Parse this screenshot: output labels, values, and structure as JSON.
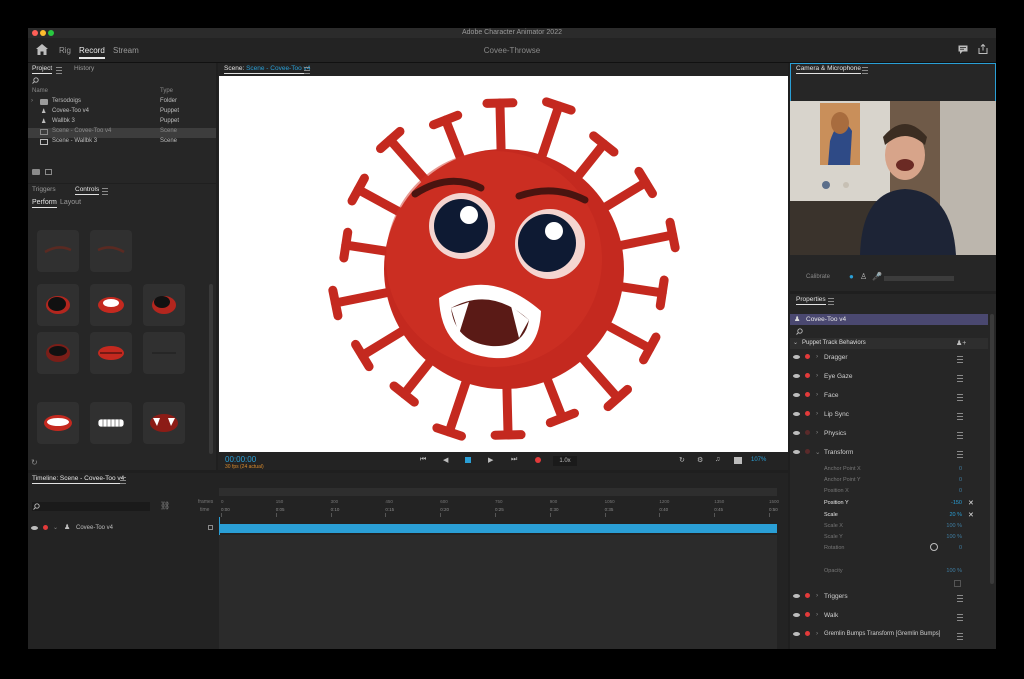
{
  "app_title": "Adobe Character Animator 2022",
  "top_tabs": [
    {
      "label": "Rig"
    },
    {
      "label": "Record"
    },
    {
      "label": "Stream"
    }
  ],
  "document_name": "Covee-Throwse",
  "project_panel": {
    "tabs": [
      "Project",
      "History"
    ],
    "columns": {
      "name": "Name",
      "type": "Type"
    },
    "items": [
      {
        "name": "Tersodoigs",
        "type": "Folder"
      },
      {
        "name": "Covee-Too v4",
        "type": "Puppet"
      },
      {
        "name": "Wallbk 3",
        "type": "Puppet"
      },
      {
        "name": "Scene - Covee-Too v4",
        "type": "Scene"
      },
      {
        "name": "Scene - Wallbk 3",
        "type": "Scene"
      }
    ]
  },
  "controls_panel": {
    "tabs": [
      "Triggers",
      "Controls"
    ],
    "subtabs": [
      "Perform",
      "Layout"
    ]
  },
  "scene_panel": {
    "label": "Scene:",
    "scene_name": "Scene - Covee-Too v4",
    "timecode": "00:00:00",
    "fps_text": "30 fps (24 actual)",
    "zoom_value": "1.0x",
    "zoom_percent": "107%"
  },
  "camera_panel": {
    "title": "Camera & Microphone",
    "calibrate_label": "Calibrate"
  },
  "properties_panel": {
    "title": "Properties",
    "puppet_name": "Covee-Too v4",
    "section": "Puppet Track Behaviors",
    "behaviors": [
      {
        "name": "Dragger"
      },
      {
        "name": "Eye Gaze"
      },
      {
        "name": "Face"
      },
      {
        "name": "Lip Sync"
      },
      {
        "name": "Physics"
      },
      {
        "name": "Transform"
      }
    ],
    "transform_params": [
      {
        "name": "Anchor Point X",
        "value": "0"
      },
      {
        "name": "Anchor Point Y",
        "value": "0"
      },
      {
        "name": "Position X",
        "value": "0"
      },
      {
        "name": "Position Y",
        "value": "-150"
      },
      {
        "name": "Scale",
        "value": "20 %"
      },
      {
        "name": "Scale X",
        "value": "100 %"
      },
      {
        "name": "Scale Y",
        "value": "100 %"
      },
      {
        "name": "Rotation",
        "value": "0"
      },
      {
        "name": "Opacity",
        "value": "100 %"
      }
    ],
    "bottom_behaviors": [
      {
        "name": "Triggers"
      },
      {
        "name": "Walk"
      },
      {
        "name": "Gremlin Bumps Transform [Gremlin Bumps]"
      }
    ]
  },
  "timeline_panel": {
    "title": "Timeline: Scene - Covee-Too v4",
    "frames_label": "frames",
    "time_label": "time",
    "frame_ticks": [
      "0",
      "150",
      "300",
      "450",
      "600",
      "750",
      "900",
      "1050",
      "1200",
      "1350",
      "1500"
    ],
    "time_ticks": [
      "0:00",
      "0:05",
      "0:10",
      "0:15",
      "0:20",
      "0:25",
      "0:30",
      "0:35",
      "0:40",
      "0:45",
      "0:50"
    ],
    "track_name": "Covee-Too v4"
  },
  "colors": {
    "accent_blue": "#2a9fd6",
    "record_red": "#e23a3a",
    "virus_red": "#c4291f",
    "puppet_highlight": "#4a4870"
  }
}
